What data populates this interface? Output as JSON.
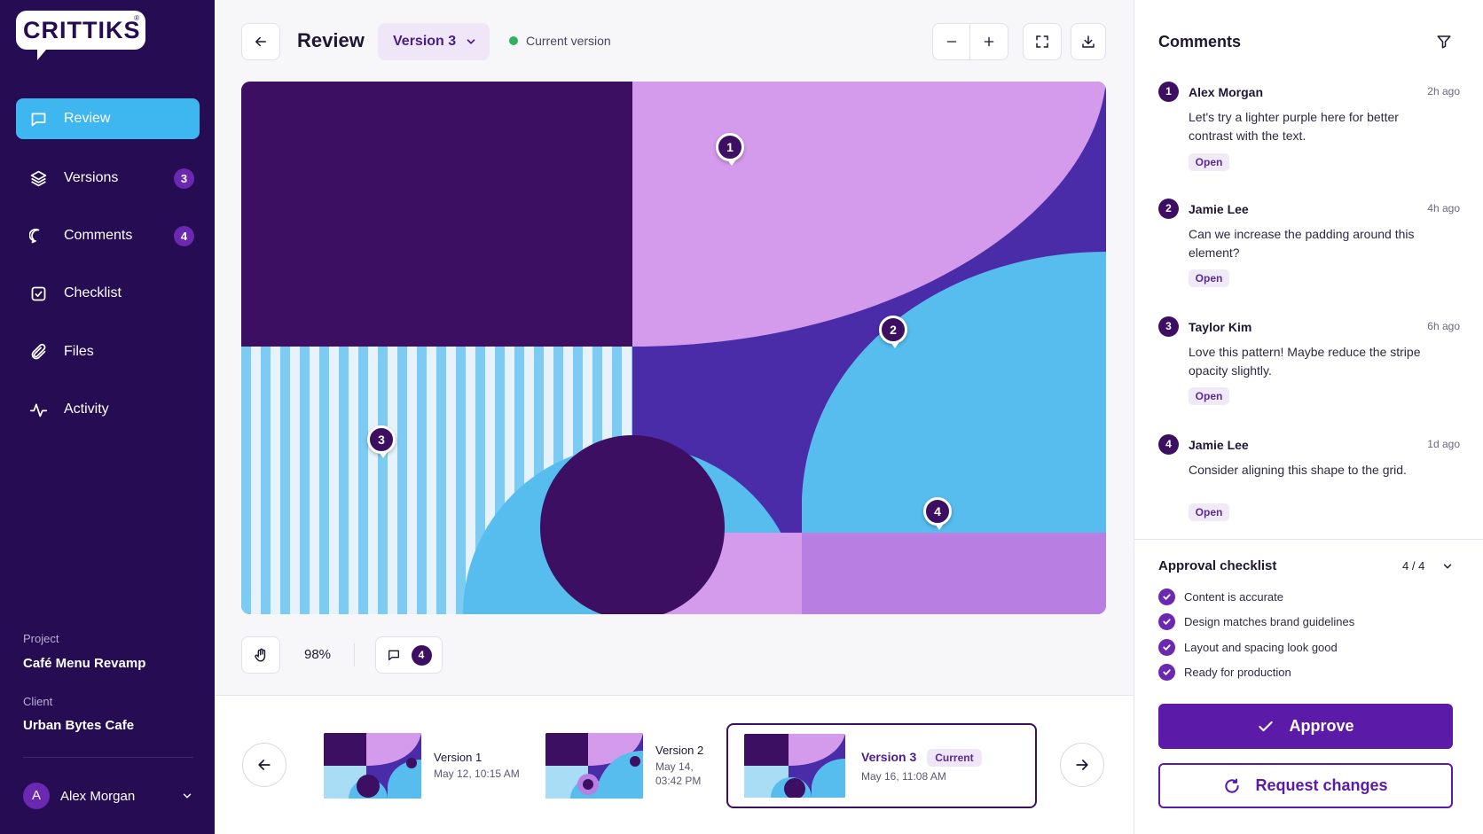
{
  "brand": {
    "logo": "CRITTIKS",
    "reg_mark": "®"
  },
  "sidebar": {
    "items": [
      {
        "label": "Review",
        "icon": "comment-square-icon",
        "badge": null,
        "active": true
      },
      {
        "label": "Versions",
        "icon": "layers-icon",
        "badge": "3"
      },
      {
        "label": "Comments",
        "icon": "comment-bubble-icon",
        "badge": "4"
      },
      {
        "label": "Checklist",
        "icon": "checkbox-icon",
        "badge": null
      },
      {
        "label": "Files",
        "icon": "paperclip-icon",
        "badge": null
      },
      {
        "label": "Activity",
        "icon": "activity-pulse-icon",
        "badge": null
      }
    ],
    "project_label": "Project",
    "project_value": "Café Menu Revamp",
    "client_label": "Client",
    "client_value": "Urban Bytes Cafe",
    "user": {
      "initial": "A",
      "name": "Alex Morgan"
    }
  },
  "header": {
    "title": "Review",
    "version_selected": "Version 3",
    "status_text": "Current version",
    "status_color": "#2fb15c"
  },
  "canvas": {
    "pins": [
      "1",
      "2",
      "3",
      "4"
    ],
    "colors": {
      "dark": "#3c0f63",
      "lilac": "#d49aec",
      "indigo": "#4a2ba8",
      "sky": "#56bdee",
      "pale": "#d9eefb",
      "mauve": "#b87ee2"
    }
  },
  "toolbar": {
    "zoom": "98%",
    "comment_count": "4"
  },
  "versions": [
    {
      "name": "Version 1",
      "date": "May 12, 10:15 AM"
    },
    {
      "name": "Version 2",
      "date_line1": "May 14,",
      "date_line2": "03:42 PM"
    },
    {
      "name": "Version 3",
      "tag": "Current",
      "date": "May 16, 11:08 AM",
      "active": true
    }
  ],
  "comments_panel": {
    "title": "Comments",
    "comments": [
      {
        "num": "1",
        "author": "Alex Morgan",
        "time": "2h ago",
        "text": "Let's try a lighter purple here for better contrast with the text.",
        "status": "Open"
      },
      {
        "num": "2",
        "author": "Jamie Lee",
        "time": "4h ago",
        "text": "Can we increase the padding around this element?",
        "status": "Open"
      },
      {
        "num": "3",
        "author": "Taylor Kim",
        "time": "6h ago",
        "text": "Love this pattern! Maybe reduce the stripe opacity slightly.",
        "status": "Open"
      },
      {
        "num": "4",
        "author": "Jamie Lee",
        "time": "1d ago",
        "text": "Consider aligning this shape to the grid.",
        "status": "Open"
      }
    ]
  },
  "checklist": {
    "title": "Approval checklist",
    "count": "4 / 4",
    "items": [
      "Content is accurate",
      "Design matches brand guidelines",
      "Layout and spacing look good",
      "Ready for production"
    ]
  },
  "actions": {
    "approve": "Approve",
    "request_changes": "Request changes",
    "accent": "#5b1aa8"
  }
}
